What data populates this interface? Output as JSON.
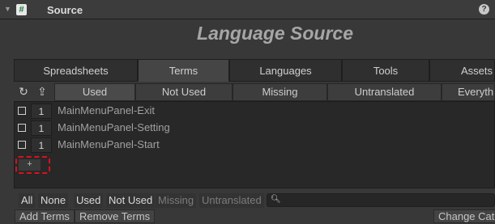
{
  "header": {
    "title": "Source",
    "script_icon": "#",
    "help_icon": "?"
  },
  "component": {
    "title": "Language Source"
  },
  "main_tabs": [
    {
      "label": "Spreadsheets",
      "active": false
    },
    {
      "label": "Terms",
      "active": true
    },
    {
      "label": "Languages",
      "active": false
    },
    {
      "label": "Tools",
      "active": false
    },
    {
      "label": "Assets",
      "active": false
    }
  ],
  "sub_tabs": [
    {
      "label": "Used",
      "active": true
    },
    {
      "label": "Not Used",
      "active": false
    },
    {
      "label": "Missing",
      "active": false
    },
    {
      "label": "Untranslated",
      "active": false
    },
    {
      "label": "Everythi",
      "active": false
    }
  ],
  "icons": {
    "refresh": "refresh-icon",
    "upload": "upload-icon"
  },
  "terms": [
    {
      "count": "1",
      "name": "MainMenuPanel-Exit"
    },
    {
      "count": "1",
      "name": "MainMenuPanel-Setting"
    },
    {
      "count": "1",
      "name": "MainMenuPanel-Start"
    }
  ],
  "add_button": "+",
  "filters": {
    "all": "All",
    "none": "None",
    "used": "Used",
    "not_used": "Not Used",
    "missing": "Missing",
    "untranslated": "Untranslated"
  },
  "search": {
    "placeholder": ""
  },
  "actions": {
    "add_terms": "Add Terms",
    "remove_terms": "Remove Terms",
    "change_category": "Change Cate"
  },
  "colors": {
    "highlight_dashed": "#d9111c",
    "background": "#383838"
  }
}
